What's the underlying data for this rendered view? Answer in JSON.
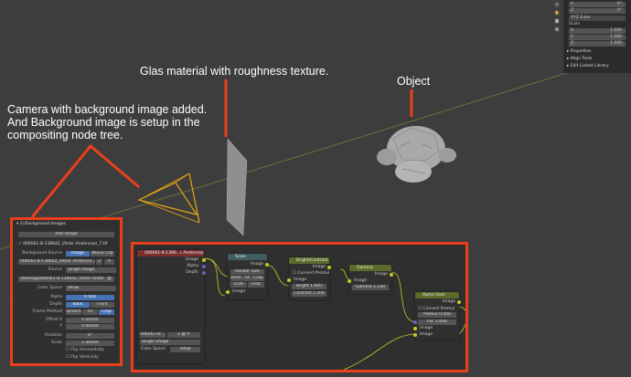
{
  "annotations": {
    "glas": "Glas material with roughness texture.",
    "object": "Object",
    "camera": "Camera with background image added.\nAnd Background image is setup in the\ncompositing node tree."
  },
  "npanel": {
    "rows_top": [
      {
        "axis": "Y",
        "value": "0°"
      },
      {
        "axis": "Z",
        "value": "0°"
      }
    ],
    "mode": "XYZ Euler",
    "scale_label": "Scale",
    "scale_rows": [
      {
        "axis": "X",
        "value": "1.000"
      },
      {
        "axis": "Y",
        "value": "1.000"
      },
      {
        "axis": "Z",
        "value": "1.000"
      }
    ],
    "sections": [
      "Properties",
      "Align Tools",
      "Edit Linked Library"
    ]
  },
  "bg_panel": {
    "title": "Background Images",
    "add_image": "Add Image",
    "entry_name": "✓ 006061-8-138642_Viktor Andersson_7.tif",
    "bg_source_label": "Background Source",
    "bg_source_image": "Image",
    "bg_source_movie": "Movie Clip",
    "image_file": "006061-8-138642_Viktor Andersso...",
    "image_users": "2",
    "source_label": "Source",
    "source_value": "Single Image",
    "filepath": "//Bilmapp006061-8-138642_Viktor Andersso...",
    "color_space_label": "Color Space",
    "color_space_value": "sRGB",
    "alpha_label": "Alpha",
    "alpha_value": "0.500",
    "depth_label": "Depth",
    "depth_back": "Back",
    "depth_front": "Front",
    "frame_method_label": "Frame Method",
    "fm_stretch": "Stretch",
    "fm_fit": "Fit",
    "fm_crop": "Crop",
    "offset_x_label": "Offset X",
    "offset_x_value": "0.00000",
    "offset_y_label": "Y",
    "offset_y_value": "0.00000",
    "rotation_label": "Rotation",
    "rotation_value": "0°",
    "scale_label": "Scale",
    "scale_value": "1.00000",
    "flip_h": "Flip Horizontally",
    "flip_v": "Flip Vertically"
  },
  "compositor": {
    "image_node": {
      "title": "006061-8-1386...r Andersson_7.tif",
      "out_image": "Image",
      "out_alpha": "Alpha",
      "out_depth": "Depth",
      "file_field": "006061-8-...",
      "source": "Single Image",
      "color_space_label": "Color Space",
      "color_space_value": "sRGB"
    },
    "scale_node": {
      "title": "Scale",
      "out_image": "Image",
      "space": "Render Size",
      "opt_stretch": "Stretch",
      "opt_fit": "Fit",
      "opt_crop": "Crop",
      "x": "0.00",
      "y": "0.00",
      "in_image": "Image"
    },
    "bc_node": {
      "title": "Bright/Contrast",
      "out_image": "Image",
      "convert": "Convert Premul",
      "in_image": "Image",
      "bright_label": "Bright",
      "bright_value": "1.000",
      "contrast_label": "Contrast",
      "contrast_value": "1.200"
    },
    "gamma_node": {
      "title": "Gamma",
      "out_image": "Image",
      "in_image": "Image",
      "gamma_label": "Gamma",
      "gamma_value": "1.140"
    },
    "alpha_node": {
      "title": "Alpha Over",
      "out_image": "Image",
      "convert": "Convert Premul",
      "premul_label": "Premul",
      "premul_value": "0.000",
      "fac_label": "Fac",
      "fac_value": "1.000",
      "in_image1": "Image",
      "in_image2": "Image"
    }
  },
  "colors": {
    "annotation_red": "#e8401c",
    "camera_yellow": "#e8a317",
    "blue_accent": "#4772b3"
  }
}
